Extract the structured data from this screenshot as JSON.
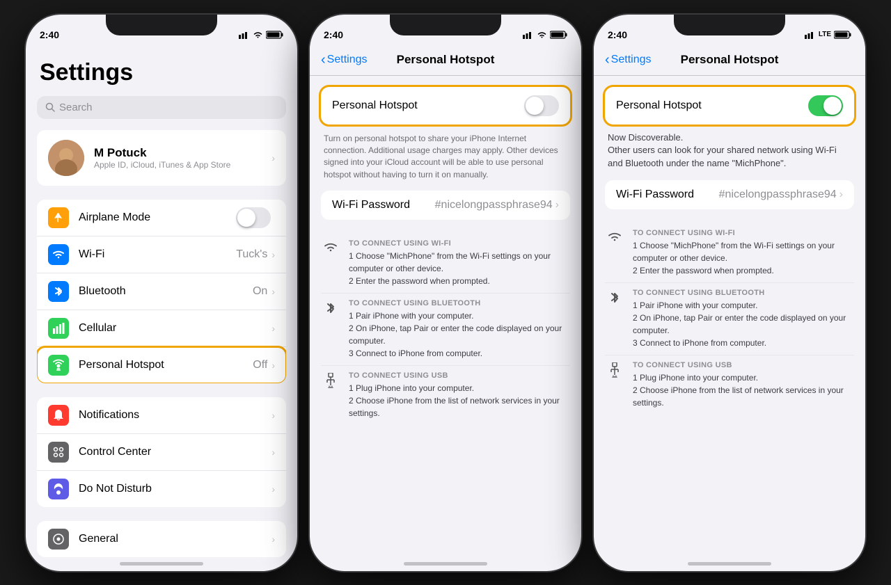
{
  "phone1": {
    "status": {
      "time": "2:40",
      "signal": "●●●",
      "wifi": "wifi",
      "battery": "🔋"
    },
    "title": "Settings",
    "search": {
      "placeholder": "Search"
    },
    "profile": {
      "name": "M Potuck",
      "subtitle": "Apple ID, iCloud, iTunes & App Store"
    },
    "groups": [
      {
        "items": [
          {
            "icon_bg": "#ff9f0a",
            "icon": "airplane",
            "label": "Airplane Mode",
            "value": "",
            "toggle": "off"
          },
          {
            "icon_bg": "#007aff",
            "icon": "wifi",
            "label": "Wi-Fi",
            "value": "Tuck's",
            "toggle": null
          },
          {
            "icon_bg": "#007aff",
            "icon": "bluetooth",
            "label": "Bluetooth",
            "value": "On",
            "toggle": null
          },
          {
            "icon_bg": "#30d158",
            "icon": "cellular",
            "label": "Cellular",
            "value": "",
            "toggle": null
          },
          {
            "icon_bg": "#30d158",
            "icon": "hotspot",
            "label": "Personal Hotspot",
            "value": "Off",
            "toggle": null,
            "highlighted": true
          }
        ]
      },
      {
        "items": [
          {
            "icon_bg": "#ff3b30",
            "icon": "notifications",
            "label": "Notifications",
            "value": "",
            "toggle": null
          },
          {
            "icon_bg": "#636366",
            "icon": "control",
            "label": "Control Center",
            "value": "",
            "toggle": null
          },
          {
            "icon_bg": "#5e5ce6",
            "icon": "donotdisturb",
            "label": "Do Not Disturb",
            "value": "",
            "toggle": null
          }
        ]
      },
      {
        "items": [
          {
            "icon_bg": "#636366",
            "icon": "general",
            "label": "General",
            "value": "",
            "toggle": null
          }
        ]
      }
    ]
  },
  "phone2": {
    "status": {
      "time": "2:40"
    },
    "nav": {
      "back": "Settings",
      "title": "Personal Hotspot"
    },
    "hotspot_toggle": {
      "label": "Personal Hotspot",
      "state": false,
      "highlighted": true
    },
    "description": "Turn on personal hotspot to share your iPhone Internet connection. Additional usage charges may apply. Other devices signed into your iCloud account will be able to use personal hotspot without having to turn it on manually.",
    "wifi_password": {
      "label": "Wi-Fi Password",
      "value": "#nicelongpassphrase94"
    },
    "connect_sections": [
      {
        "icon": "wifi",
        "title": "TO CONNECT USING WI-FI",
        "steps": "1 Choose \"MichPhone\" from the Wi-Fi settings on your computer or other device.\n2 Enter the password when prompted."
      },
      {
        "icon": "bluetooth",
        "title": "TO CONNECT USING BLUETOOTH",
        "steps": "1 Pair iPhone with your computer.\n2 On iPhone, tap Pair or enter the code displayed on your computer.\n3 Connect to iPhone from computer."
      },
      {
        "icon": "usb",
        "title": "TO CONNECT USING USB",
        "steps": "1 Plug iPhone into your computer.\n2 Choose iPhone from the list of network services in your settings."
      }
    ]
  },
  "phone3": {
    "status": {
      "time": "2:40",
      "carrier": "LTE"
    },
    "nav": {
      "back": "Settings",
      "title": "Personal Hotspot"
    },
    "hotspot_toggle": {
      "label": "Personal Hotspot",
      "state": true,
      "highlighted": true
    },
    "discoverable": "Now Discoverable.\nOther users can look for your shared network using Wi-Fi and Bluetooth under the name \"MichPhone\".",
    "wifi_password": {
      "label": "Wi-Fi Password",
      "value": "#nicelongpassphrase94"
    },
    "connect_sections": [
      {
        "icon": "wifi",
        "title": "TO CONNECT USING WI-FI",
        "steps": "1 Choose \"MichPhone\" from the Wi-Fi settings on your computer or other device.\n2 Enter the password when prompted."
      },
      {
        "icon": "bluetooth",
        "title": "TO CONNECT USING BLUETOOTH",
        "steps": "1 Pair iPhone with your computer.\n2 On iPhone, tap Pair or enter the code displayed on your computer.\n3 Connect to iPhone from computer."
      },
      {
        "icon": "usb",
        "title": "TO CONNECT USING USB",
        "steps": "1 Plug iPhone into your computer.\n2 Choose iPhone from the list of network services in your settings."
      }
    ]
  }
}
